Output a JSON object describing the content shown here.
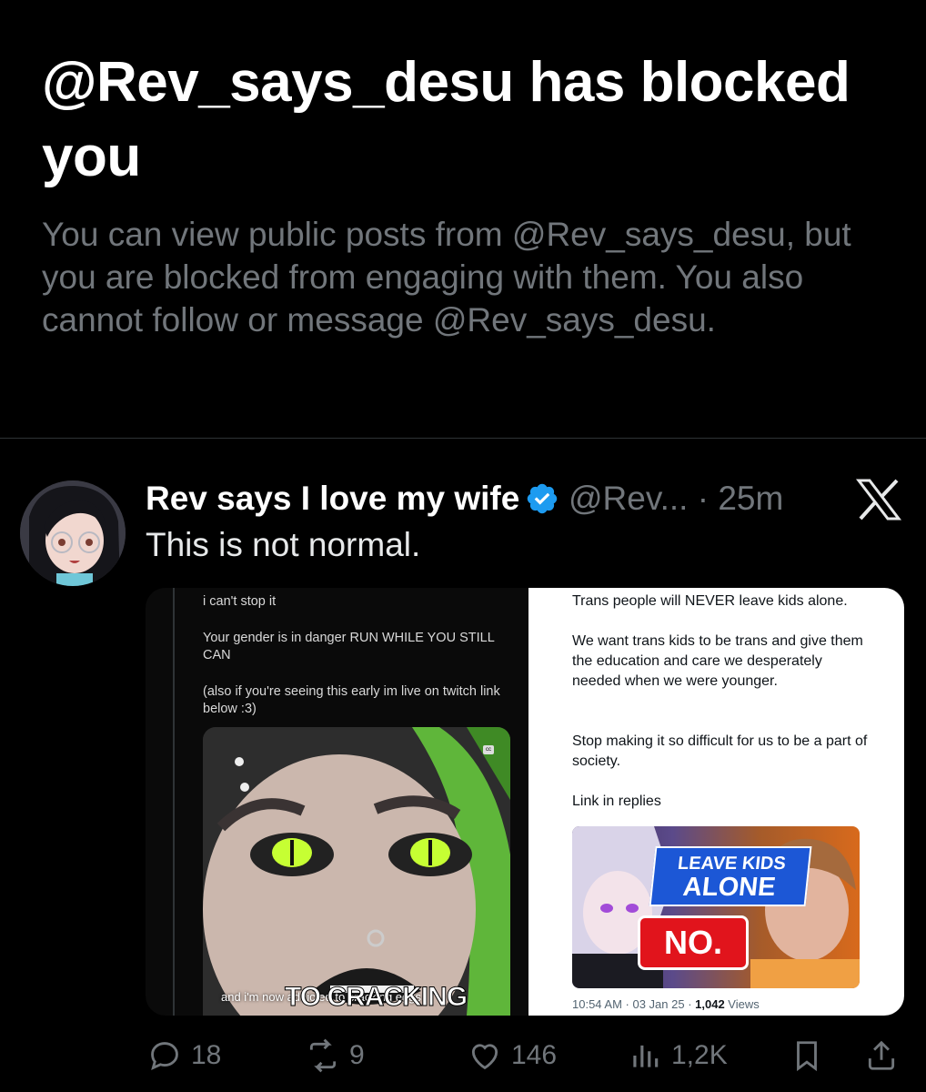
{
  "blocked": {
    "title": "@Rev_says_desu has blocked you",
    "description": "You can view public posts from @Rev_says_desu, but you are blocked from engaging with them. You also cannot follow or message @Rev_says_desu."
  },
  "tweet": {
    "display_name": "Rev says I love my wife",
    "handle": "@Rev...",
    "separator": "·",
    "time": "25m",
    "text": "This is not normal.",
    "verified_icon": "verified-badge-icon",
    "platform_icon": "x-logo-icon"
  },
  "media": {
    "left_post": {
      "line1": "i can't stop it",
      "line2": "Your gender is in danger RUN WHILE YOU STILL CAN",
      "line3": "(also if you're seeing this early im live on twitch link below :3)",
      "video_caption_small": "and i'm now addicted to cracking eggs",
      "video_caption_big": "TO CRACKING"
    },
    "right_post": {
      "p1": "Trans people will NEVER leave kids alone.",
      "p2": "We want trans kids to be trans and give them the education and care we desperately needed when we were younger.",
      "p3": "Stop making it so difficult for us to be a part of society.",
      "p4": "Link in replies",
      "thumb_leave_line1": "LEAVE KIDS",
      "thumb_leave_line2": "ALONE",
      "thumb_no": "NO.",
      "timestamp": "10:54 AM · 03 Jan 25 · ",
      "views_count": "1,042",
      "views_label": " Views"
    }
  },
  "actions": {
    "replies": "18",
    "reposts": "9",
    "likes": "146",
    "views": "1,2K"
  },
  "colors": {
    "background": "#000000",
    "muted": "#71767b",
    "verified": "#1d9bf0",
    "divider": "#2f3336"
  }
}
